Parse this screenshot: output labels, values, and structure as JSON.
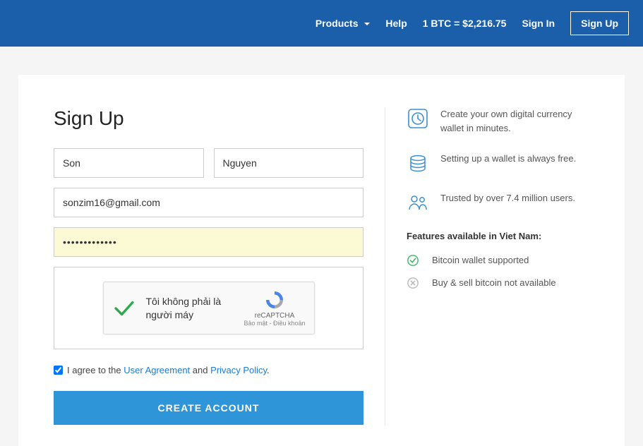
{
  "header": {
    "products": "Products",
    "help": "Help",
    "btc_rate": "1 BTC = $2,216.75",
    "signin": "Sign In",
    "signup": "Sign Up"
  },
  "form": {
    "title": "Sign Up",
    "first_name": "Son",
    "last_name": "Nguyen",
    "email": "sonzim16@gmail.com",
    "password": "•••••••••••••",
    "captcha_text": "Tôi không phải là người máy",
    "captcha_brand": "reCAPTCHA",
    "captcha_terms": "Bảo mật - Điều khoản",
    "agree_prefix": "I agree to the ",
    "agree_link1": "User Agreement",
    "agree_middle": " and ",
    "agree_link2": "Privacy Policy",
    "agree_suffix": ".",
    "submit": "CREATE ACCOUNT"
  },
  "side": {
    "benefits": [
      "Create your own digital currency wallet in minutes.",
      "Setting up a wallet is always free.",
      "Trusted by over 7.4 million users."
    ],
    "features_title": "Features available in Viet Nam:",
    "features": [
      "Bitcoin wallet supported",
      "Buy & sell bitcoin not available"
    ]
  }
}
